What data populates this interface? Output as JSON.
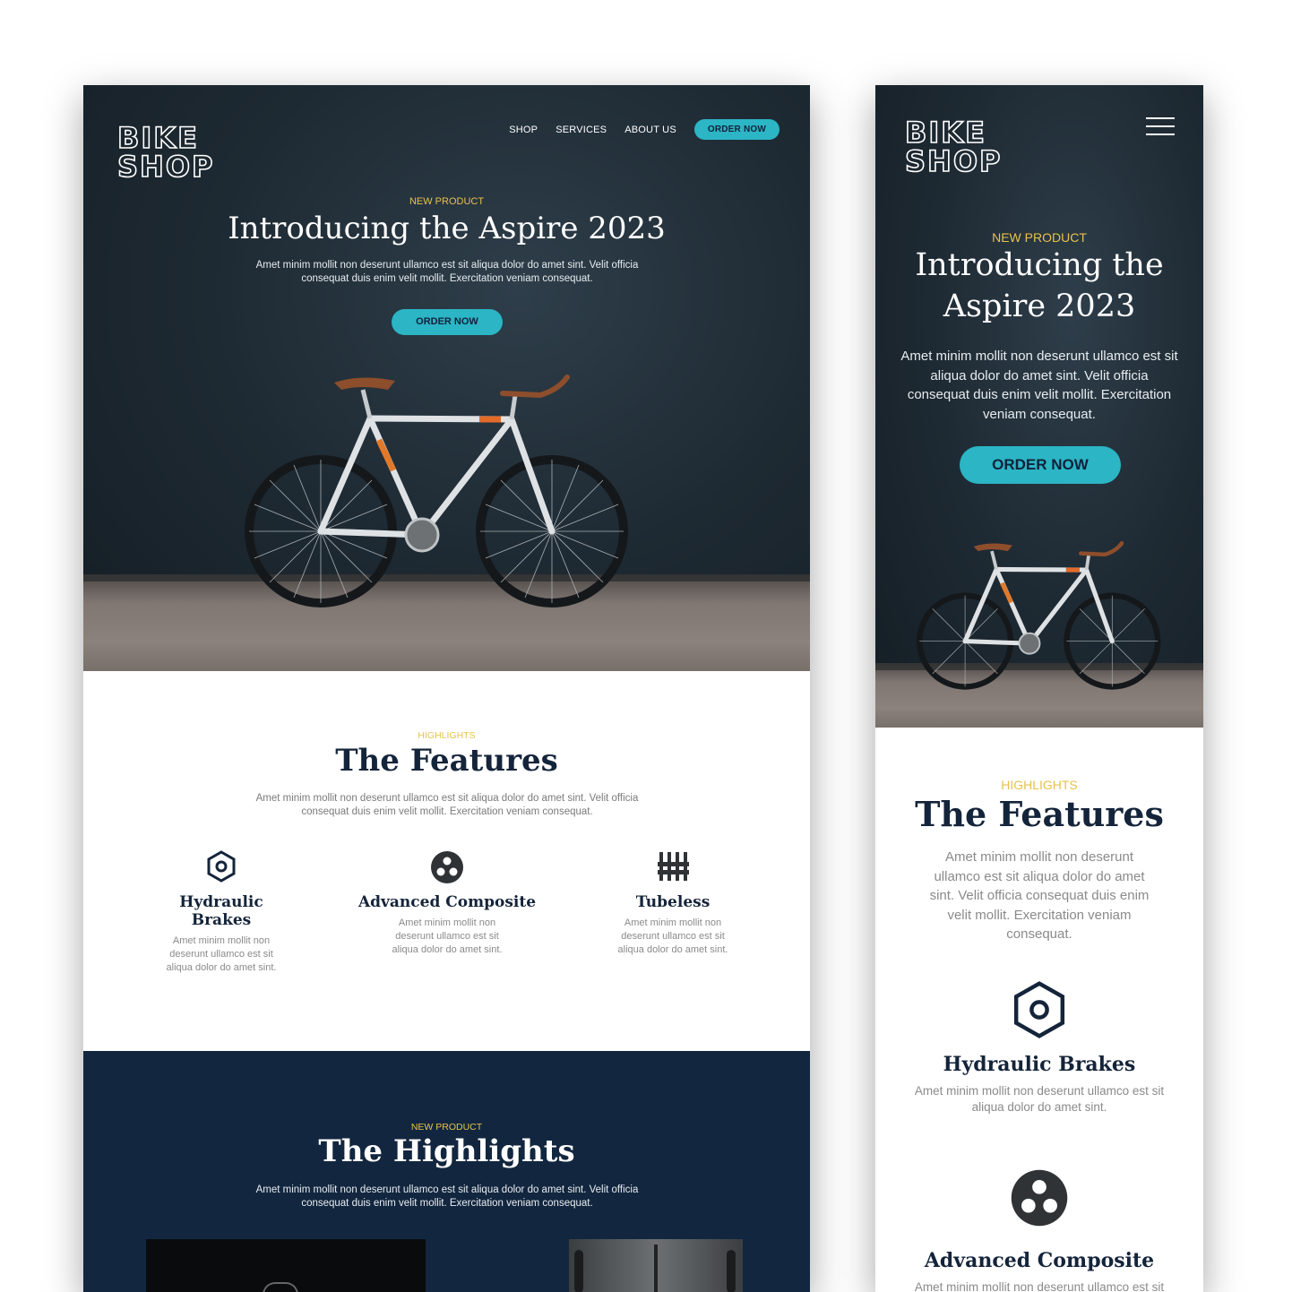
{
  "brand": {
    "logo_line1": "BIKE",
    "logo_line2": "SHOP"
  },
  "nav": {
    "shop": "SHOP",
    "services": "SERVICES",
    "about": "ABOUT US",
    "cta": "ORDER NOW"
  },
  "hero": {
    "eyebrow": "NEW PRODUCT",
    "title": "Introducing the Aspire 2023",
    "title_line1": "Introducing the",
    "title_line2": "Aspire 2023",
    "body": "Amet minim mollit non deserunt ullamco est sit aliqua dolor do amet sint. Velit officia consequat duis enim velit mollit. Exercitation veniam consequat.",
    "cta": "ORDER NOW"
  },
  "features": {
    "eyebrow": "HIGHLIGHTS",
    "title": "The Features",
    "body": "Amet minim mollit non deserunt ullamco est sit aliqua dolor do amet sint. Velit officia consequat duis enim velit mollit. Exercitation veniam consequat.",
    "items": [
      {
        "icon": "hex-nut-icon",
        "title": "Hydraulic Brakes",
        "desc": "Amet minim mollit non deserunt ullamco est sit aliqua dolor do amet sint."
      },
      {
        "icon": "three-dots-circle-icon",
        "title": "Advanced Composite",
        "desc": "Amet minim mollit non deserunt ullamco est sit aliqua dolor do amet sint."
      },
      {
        "icon": "sliders-icon",
        "title": "Tubeless",
        "desc": "Amet minim mollit non deserunt ullamco est sit aliqua dolor do amet sint."
      }
    ]
  },
  "highlights": {
    "eyebrow": "NEW PRODUCT",
    "title": "The Highlights",
    "body": "Amet minim mollit non deserunt ullamco est sit aliqua dolor do amet sint. Velit officia consequat duis enim velit mollit. Exercitation veniam consequat."
  },
  "colors": {
    "accent": "#2bb5c5",
    "eyebrow": "#e7c24c",
    "navy": "#12263f",
    "dark_hero": "#1e2a33"
  }
}
